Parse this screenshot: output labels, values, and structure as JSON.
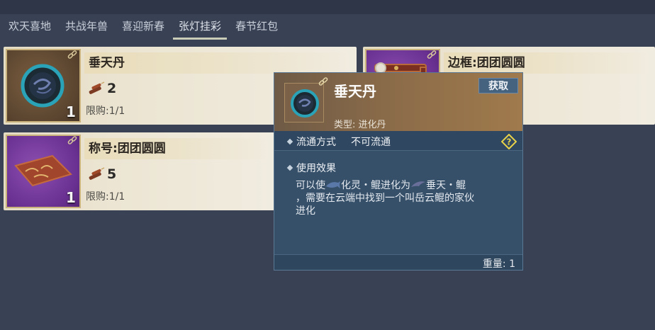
{
  "tabs": [
    "欢天喜地",
    "共战年兽",
    "喜迎新春",
    "张灯挂彩",
    "春节红包"
  ],
  "active_tab_index": 3,
  "cards": [
    {
      "title": "垂天丹",
      "price": "2",
      "limit": "限购:1/1",
      "qty": "1",
      "thumb_icon": "dark-orb-icon",
      "currency_icon": "firecracker-icon"
    },
    {
      "title": "边框:团团圆圆",
      "thumb_icon": "ornate-frame-icon"
    },
    {
      "title": "称号:团团圆圆",
      "price": "5",
      "limit": "限购:1/1",
      "qty": "1",
      "thumb_icon": "title-plaque-icon",
      "currency_icon": "firecracker-icon"
    }
  ],
  "tooltip": {
    "title": "垂天丹",
    "type": "类型: 进化丹",
    "obtain_button": "获取",
    "circulation_label": "流通方式",
    "circulation_value": "不可流通",
    "effect_label": "使用效果",
    "desc": {
      "part1": "可以使",
      "part2": "化灵・鲲进化为",
      "part3": "垂天・鲲",
      "part4": "，需要在云端中找到一个叫岳云鲲的家伙",
      "part5": "进化"
    },
    "weight": "重量: 1"
  },
  "colors": {
    "background": "#394255",
    "card_bg": "#ece5d3",
    "tooltip_bg": "#36506a",
    "tooltip_header": "#8a6b49",
    "help_icon": "#e8d24a"
  }
}
